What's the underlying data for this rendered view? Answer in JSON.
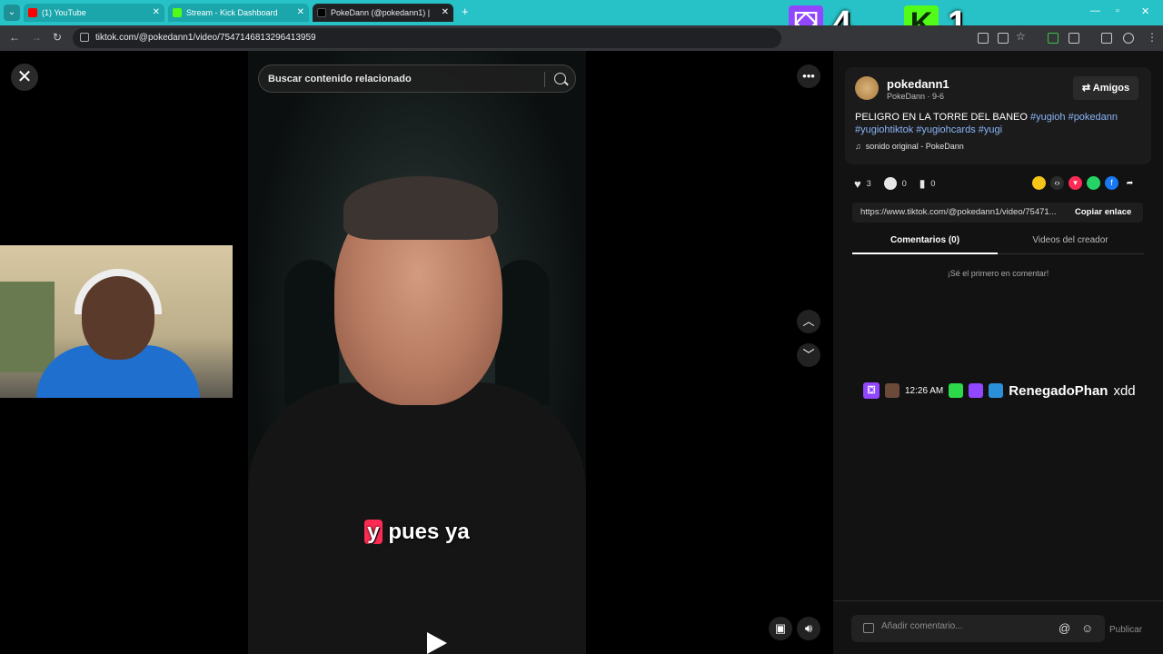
{
  "browser": {
    "tabs": [
      {
        "title": "(1) YouTube",
        "favicon_color": "#ff0000"
      },
      {
        "title": "Stream - Kick Dashboard",
        "favicon_color": "#53fc18"
      },
      {
        "title": "PokeDann (@pokedann1) |",
        "favicon_color": "#000000"
      }
    ],
    "url": "tiktok.com/@pokedann1/video/7547146813296413959"
  },
  "overlay": {
    "twitch_count": "4",
    "kick_count": "1",
    "twitch_color": "#9146ff",
    "kick_color": "#53fc18"
  },
  "video": {
    "search_placeholder": "Buscar contenido relacionado",
    "caption_highlight": "y",
    "caption_rest": "pues ya"
  },
  "author": {
    "username": "pokedann1",
    "subline": "PokeDann · 9-6",
    "friends_label": "Amigos"
  },
  "description": {
    "text": "PELIGRO EN LA TORRE DEL BANEO ",
    "hashtags_line1": "#yugioh #pokedann",
    "hashtags_line2": "#yugiohtiktok #yugiohcards #yugi",
    "sound": "sonido original - PokeDann"
  },
  "stats": {
    "likes": "3",
    "comments": "0",
    "saves": "0"
  },
  "share": {
    "link": "https://www.tiktok.com/@pokedann1/video/75471...",
    "copy_label": "Copiar enlace"
  },
  "tabs": {
    "comments": "Comentarios (0)",
    "creator_videos": "Videos del creador"
  },
  "comments": {
    "empty_text": "¡Sé el primero en comentar!",
    "input_placeholder": "Añadir comentario...",
    "post_label": "Publicar"
  },
  "chat_overlay": {
    "time": "12:26 AM",
    "user": "RenegadoPhan",
    "message": "xdd"
  }
}
